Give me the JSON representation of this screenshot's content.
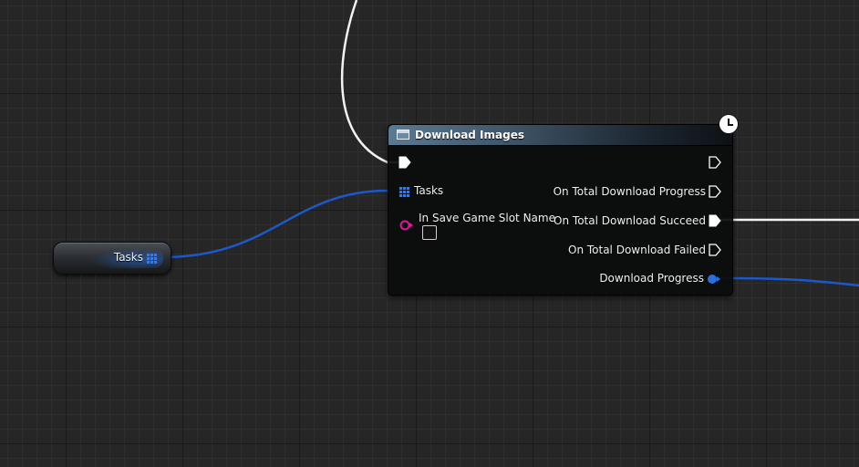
{
  "graph": {
    "wire_colors": {
      "exec": "#ffffff",
      "array_struct": "#1a56c4",
      "float": "#1a56c4"
    }
  },
  "variable_node": {
    "label": "Tasks",
    "icon": "array-icon",
    "pin_color": "#2a7bff"
  },
  "function_node": {
    "title": "Download Images",
    "header_icon": "function-node-icon",
    "latent_icon": "clock-icon",
    "inputs": {
      "exec": "",
      "tasks_label": "Tasks",
      "slot_name_label": "In Save Game Slot Name"
    },
    "outputs": {
      "then": "",
      "on_total_download_progress": "On Total Download Progress",
      "on_total_download_succeed": "On Total Download Succeed",
      "on_total_download_failed": "On Total Download Failed",
      "download_progress": "Download Progress"
    },
    "pin_colors": {
      "string": "#e0149a",
      "array": "#2a7bff",
      "float": "#2a7bff",
      "exec": "#ffffff"
    }
  }
}
